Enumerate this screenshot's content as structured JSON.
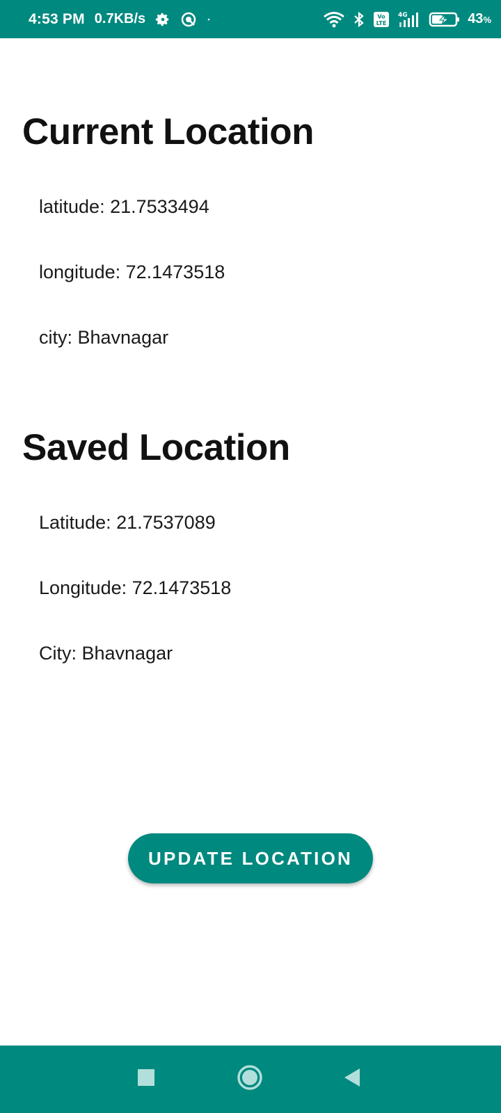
{
  "status_bar": {
    "time": "4:53 PM",
    "net_speed": "0.7KB/s",
    "battery_value": "43",
    "battery_unit": "%",
    "icons_left": [
      "gear-icon",
      "target-icon",
      "dot-icon"
    ],
    "icons_right": [
      "wifi-icon",
      "bluetooth-icon",
      "volte-icon",
      "signal-4g-icon",
      "battery-charging-icon"
    ]
  },
  "current_location": {
    "title": "Current Location",
    "latitude": "latitude: 21.7533494",
    "longitude": "longitude: 72.1473518",
    "city": "city: Bhavnagar"
  },
  "saved_location": {
    "title": "Saved Location",
    "latitude": "Latitude: 21.7537089",
    "longitude": "Longitude: 72.1473518",
    "city": "City: Bhavnagar"
  },
  "actions": {
    "update_label": "UPDATE LOCATION"
  },
  "nav_bar": {
    "buttons": [
      "recents-square-icon",
      "home-circle-icon",
      "back-triangle-icon"
    ]
  },
  "colors": {
    "accent": "#00897f",
    "nav_icon": "#b2dfdb"
  }
}
